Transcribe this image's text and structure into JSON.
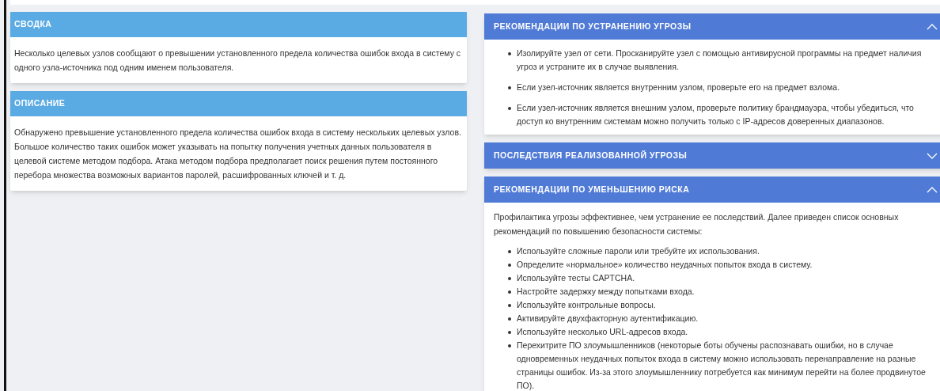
{
  "left_panels": [
    {
      "title": "СВОДКА",
      "text": "Несколько целевых узлов сообщают о превышении установленного предела количества ошибок входа в систему с одного узла-источника под одним именем пользователя."
    },
    {
      "title": "ОПИСАНИЕ",
      "text": "Обнаружено превышение установленного предела количества ошибок входа в систему нескольких целевых узлов. Большое количество таких ошибок может указывать на попытку получения учетных данных пользователя в целевой системе методом подбора. Атака методом подбора предполагает поиск решения путем постоянного перебора множества возможных вариантов паролей, расшифрованных ключей и т. д."
    }
  ],
  "accordion": [
    {
      "title": "РЕКОМЕНДАЦИИ ПО УСТРАНЕНИЮ УГРОЗЫ",
      "expanded": true,
      "bullets": [
        "Изолируйте узел от сети. Просканируйте узел с помощью антивирусной программы на предмет наличия угроз и устраните их в случае выявления.",
        "Если узел-источник является внутренним узлом, проверьте его на предмет взлома.",
        "Если узел-источник является внешним узлом, проверьте политику брандмауэра, чтобы убедиться, что доступ ко внутренним системам можно получить только с IP-адресов доверенных диапазонов."
      ]
    },
    {
      "title": "ПОСЛЕДСТВИЯ РЕАЛИЗОВАННОЙ УГРОЗЫ",
      "expanded": false
    },
    {
      "title": "РЕКОМЕНДАЦИИ ПО УМЕНЬШЕНИЮ РИСКА",
      "expanded": true,
      "intro": "Профилактика угрозы эффективнее, чем устранение ее последствий. Далее приведен список основных рекомендаций по повышению безопасности системы:",
      "bullets": [
        "Используйте сложные пароли или требуйте их использования.",
        "Определите «нормальное» количество неудачных попыток входа в систему.",
        "Используйте тесты CAPTCHA.",
        "Настройте задержку между попытками входа.",
        "Используйте контрольные вопросы.",
        "Активируйте двухфакторную аутентификацию.",
        "Используйте несколько URL-адресов входа.",
        "Перехитрите ПО злоумышленников (некоторые боты обучены распознавать ошибки, но в случае одновременных неудачных попыток входа в систему можно использовать перенаправление на разные страницы ошибок. Из-за этого злоумышленнику потребуется как минимум перейти на более продвинутое ПО)."
      ]
    }
  ]
}
